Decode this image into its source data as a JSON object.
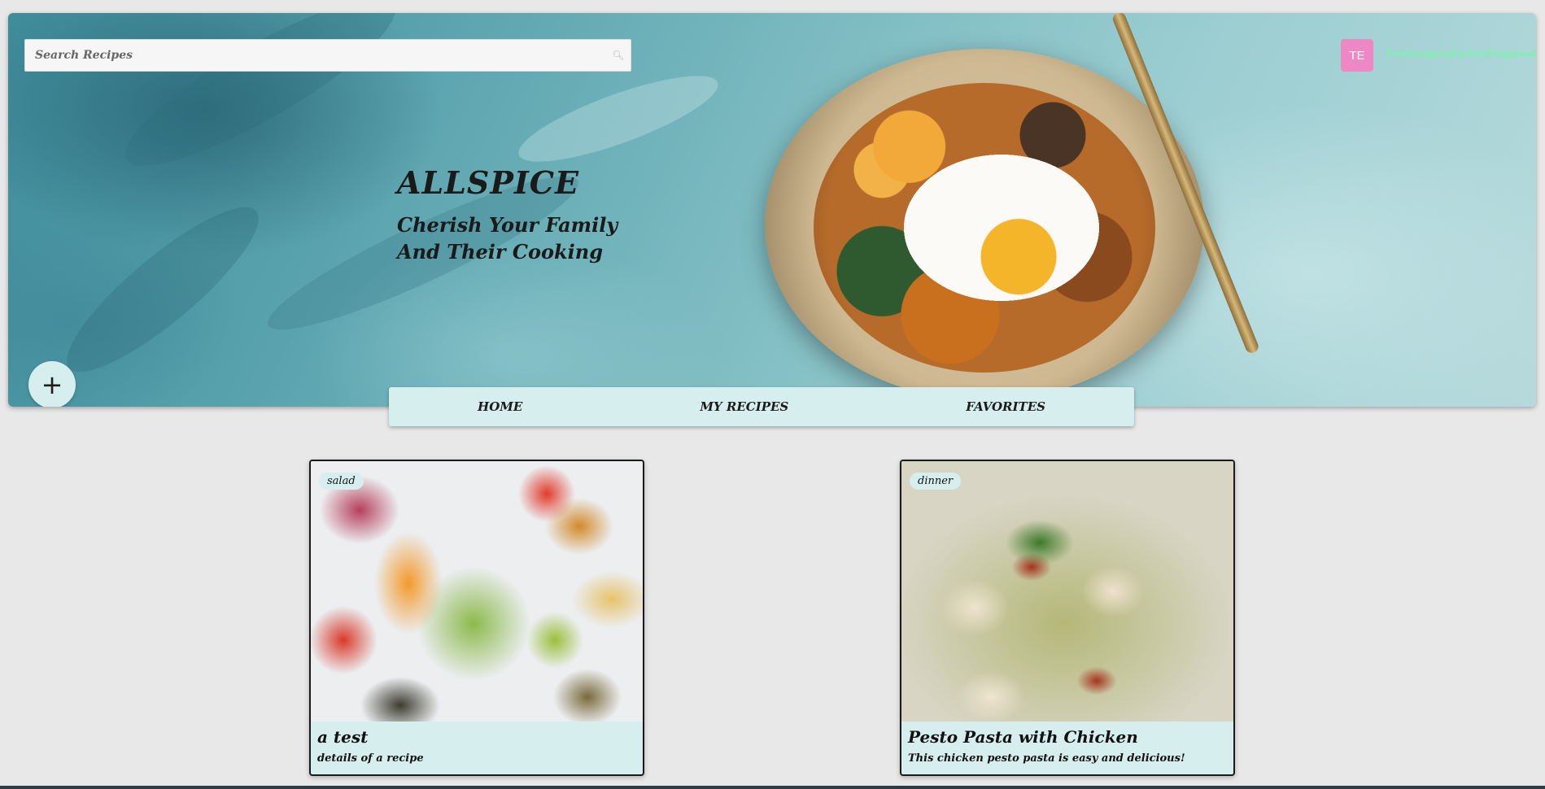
{
  "header": {
    "search": {
      "placeholder": "Search Recipes",
      "icon": "search-icon"
    },
    "user": {
      "initials": "TE",
      "email": "testinggood@testinggood.com",
      "avatar_color": "#ee88c4",
      "email_color": "#7ff0b0"
    }
  },
  "brand": {
    "title": "ALLSPICE",
    "tagline_line1": "Cherish Your Family",
    "tagline_line2": "And Their Cooking"
  },
  "add_button": {
    "label": "+"
  },
  "nav": {
    "items": [
      {
        "label": "HOME"
      },
      {
        "label": "MY RECIPES"
      },
      {
        "label": "FAVORITES"
      }
    ]
  },
  "recipes": [
    {
      "category": "salad",
      "title": "a test",
      "description": "details of a recipe"
    },
    {
      "category": "dinner",
      "title": "Pesto Pasta with Chicken",
      "description": "This chicken pesto pasta is easy and delicious!"
    }
  ],
  "colors": {
    "accent": "#d6eeee",
    "background": "#e8e8e8"
  }
}
